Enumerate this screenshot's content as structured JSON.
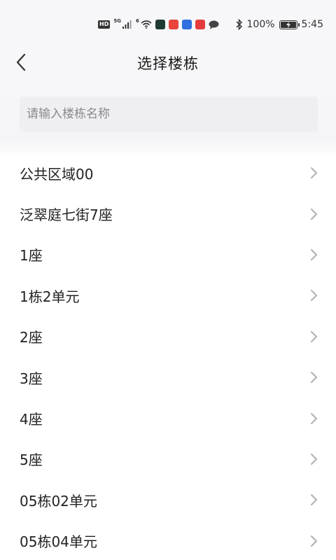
{
  "status_bar": {
    "hd": "HD",
    "sig1": "5G",
    "sig2": "6",
    "battery_percent": "100%",
    "time": "5:45",
    "icons": [
      "signal-icon",
      "wifi-icon",
      "bluetooth-icon",
      "battery-icon",
      "message-icon"
    ]
  },
  "header": {
    "title": "选择楼栋",
    "back_icon": "chevron-left-icon"
  },
  "search": {
    "placeholder": "请输入楼栋名称"
  },
  "buildings": [
    {
      "label": "公共区域00"
    },
    {
      "label": "泛翠庭七街7座"
    },
    {
      "label": "1座"
    },
    {
      "label": "1栋2单元"
    },
    {
      "label": "2座"
    },
    {
      "label": "3座"
    },
    {
      "label": "4座"
    },
    {
      "label": "5座"
    },
    {
      "label": "05栋02单元"
    },
    {
      "label": "05栋04单元"
    }
  ],
  "colors": {
    "background": "#ffffff",
    "header_bg": "#f7f7f9",
    "search_bg": "#efeff2",
    "chevron": "#b0b0b4"
  }
}
